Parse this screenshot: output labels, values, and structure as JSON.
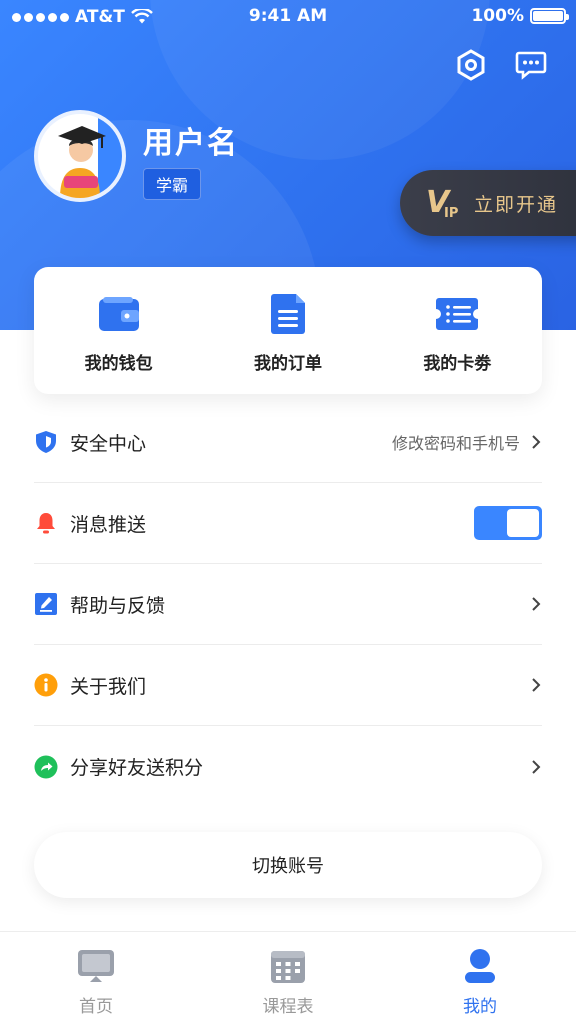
{
  "status_bar": {
    "carrier": "AT&T",
    "time": "9:41 AM",
    "battery": "100%"
  },
  "profile": {
    "username": "用户名",
    "badge": "学霸"
  },
  "vip": {
    "label": "立即开通",
    "mark": "V",
    "mark_sub": "IP"
  },
  "quick_actions": [
    {
      "label": "我的钱包",
      "icon": "wallet-icon"
    },
    {
      "label": "我的订单",
      "icon": "order-document-icon"
    },
    {
      "label": "我的卡劵",
      "icon": "coupon-card-icon"
    }
  ],
  "menu": [
    {
      "title": "安全中心",
      "sub": "修改密码和手机号",
      "icon": "shield-icon",
      "color": "#2f72ef"
    },
    {
      "title": "消息推送",
      "icon": "bell-icon",
      "color": "#ff4b3a",
      "toggle": true
    },
    {
      "title": "帮助与反馈",
      "icon": "edit-pencil-icon",
      "color": "#2f72ef"
    },
    {
      "title": "关于我们",
      "icon": "info-icon",
      "color": "#ff9f0a"
    },
    {
      "title": "分享好友送积分",
      "icon": "share-arrow-icon",
      "color": "#1fc05a"
    }
  ],
  "switch_account": "切换账号",
  "tabs": [
    {
      "label": "首页",
      "icon": "monitor-icon",
      "active": false
    },
    {
      "label": "课程表",
      "icon": "calendar-grid-icon",
      "active": false
    },
    {
      "label": "我的",
      "icon": "user-icon",
      "active": true
    }
  ],
  "colors": {
    "primary": "#2f72ef",
    "vip_gold": "#e7c68b",
    "vip_bg": "#33363f"
  }
}
